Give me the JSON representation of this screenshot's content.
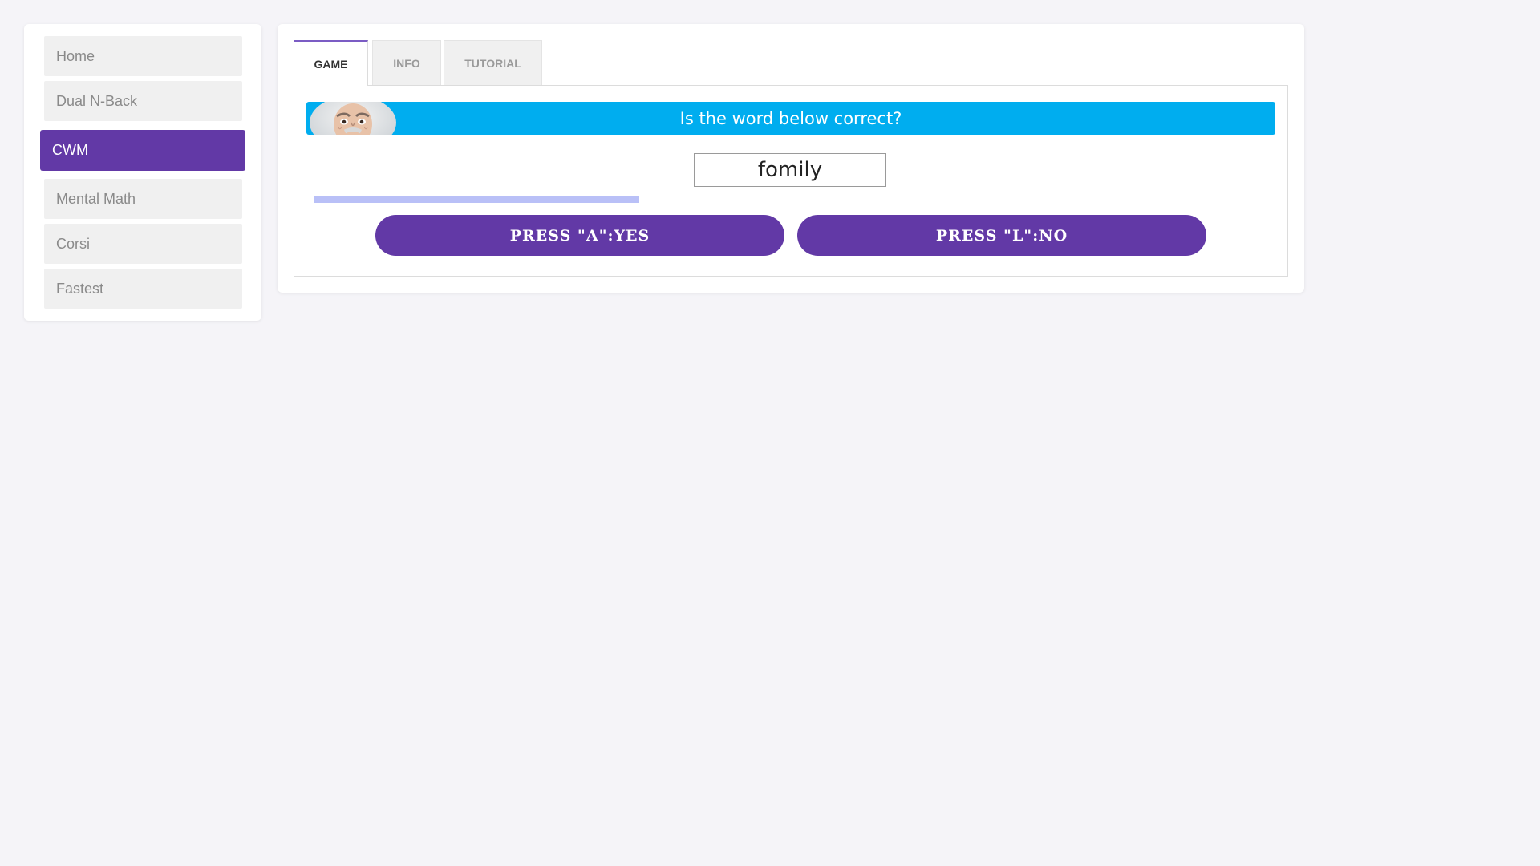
{
  "sidebar": {
    "items": [
      {
        "label": "Home",
        "active": false
      },
      {
        "label": "Dual N-Back",
        "active": false
      },
      {
        "label": "CWM",
        "active": true
      },
      {
        "label": "Mental Math",
        "active": false
      },
      {
        "label": "Corsi",
        "active": false
      },
      {
        "label": "Fastest",
        "active": false
      }
    ]
  },
  "tabs": [
    {
      "label": "GAME",
      "active": true
    },
    {
      "label": "INFO",
      "active": false
    },
    {
      "label": "TUTORIAL",
      "active": false
    }
  ],
  "game": {
    "prompt": "Is the word below correct?",
    "word": "fomily",
    "timer_fraction": 0.34,
    "yes_button": "PRESS \"A\":YES",
    "no_button": "PRESS \"L\":NO"
  },
  "colors": {
    "accent": "#6239a6",
    "banner": "#00adef",
    "timer_bar": "#b9c0f7",
    "background": "#f5f4f8"
  },
  "icons": {
    "banner_avatar": "einstein-portrait-icon"
  }
}
